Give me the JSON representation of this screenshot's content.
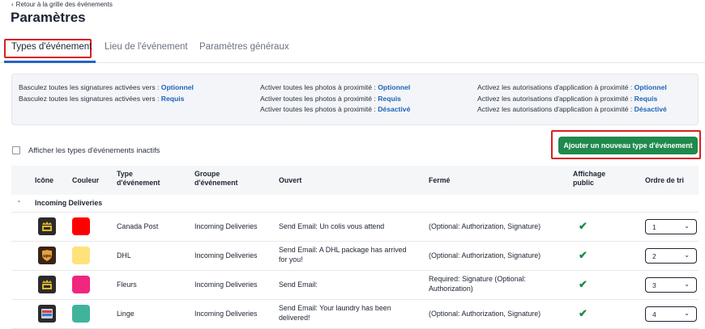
{
  "header": {
    "back_link": "Retour à la grille des événements",
    "title": "Paramètres"
  },
  "tabs": [
    {
      "label": "Types d'événement",
      "active": true
    },
    {
      "label": "Lieu de l'événement",
      "active": false
    },
    {
      "label": "Paramètres généraux",
      "active": false
    }
  ],
  "settings": {
    "signatures": [
      {
        "text": "Basculez toutes les signatures activées vers : ",
        "link": "Optionnel"
      },
      {
        "text": "Basculez toutes les signatures activées vers : ",
        "link": "Requis"
      }
    ],
    "photos": [
      {
        "text": "Activer toutes les photos à proximité : ",
        "link": "Optionnel"
      },
      {
        "text": "Activer toutes les photos à proximité : ",
        "link": "Requis"
      },
      {
        "text": "Activer toutes les photos à proximité : ",
        "link": "Désactivé"
      }
    ],
    "authorizations": [
      {
        "text": "Activez les autorisations d'application à proximité : ",
        "link": "Optionnel"
      },
      {
        "text": "Activez les autorisations d'application à proximité : ",
        "link": "Requis"
      },
      {
        "text": "Activez les autorisations d'application à proximité : ",
        "link": "Désactivé"
      }
    ]
  },
  "show_inactive_label": "Afficher les types d'événements inactifs",
  "add_button_label": "Ajouter un nouveau type d'événement",
  "table": {
    "headers": {
      "icon": "Icône",
      "color": "Couleur",
      "type_line1": "Type",
      "type_line2": "d'événement",
      "group_line1": "Groupe",
      "group_line2": "d'événement",
      "open": "Ouvert",
      "closed": "Fermé",
      "public_line1": "Affichage",
      "public_line2": "public",
      "sort": "Ordre de tri"
    },
    "group_name": "Incoming Deliveries",
    "rows": [
      {
        "icon": "crown-package-icon",
        "color": "#ff0000",
        "type": "Canada Post",
        "group": "Incoming Deliveries",
        "open_line1": "Send Email: Un colis vous attend",
        "open_line2": "",
        "closed_line1": "(Optional: Authorization, Signature)",
        "closed_line2": "",
        "check": "✔",
        "sort": "1"
      },
      {
        "icon": "ups-shield-icon",
        "color": "#ffe27a",
        "type": "DHL",
        "group": "Incoming Deliveries",
        "open_line1": "Send Email: A DHL package has arrived",
        "open_line2": "for you!",
        "closed_line1": "(Optional: Authorization, Signature)",
        "closed_line2": "",
        "check": "✔",
        "sort": "2"
      },
      {
        "icon": "crown-package-icon",
        "color": "#f0267f",
        "type": "Fleurs",
        "group": "Incoming Deliveries",
        "open_line1": "Send Email:",
        "open_line2": "",
        "closed_line1": "Required: Signature (Optional:",
        "closed_line2": "Authorization)",
        "check": "✔",
        "sort": "3"
      },
      {
        "icon": "laundry-icon",
        "color": "#40b39b",
        "type": "Linge",
        "group": "Incoming Deliveries",
        "open_line1": "Send Email: Your laundry has been",
        "open_line2": "delivered!",
        "closed_line1": "(Optional: Authorization, Signature)",
        "closed_line2": "",
        "check": "✔",
        "sort": "4"
      }
    ]
  }
}
